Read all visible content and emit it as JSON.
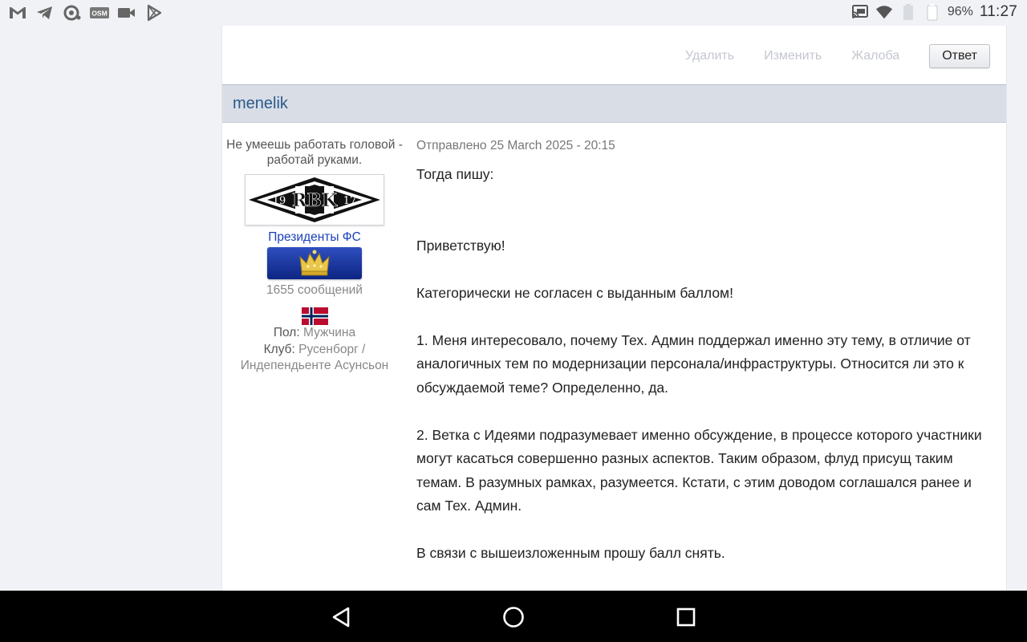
{
  "status": {
    "time": "11:27",
    "battery": "96%",
    "left_icons": [
      "gmail-icon",
      "telegram-icon",
      "music-sync-icon",
      "osm-icon",
      "video-camera-icon",
      "play-store-icon"
    ],
    "osm_label": "OSM"
  },
  "actions": {
    "delete": "Удалить",
    "edit": "Изменить",
    "report": "Жалоба",
    "reply": "Ответ"
  },
  "author": {
    "name": "menelik",
    "tagline": "Не умеешь работать головой - работай руками.",
    "avatar_text": "RBK",
    "avatar_year_left": "19",
    "avatar_year_right": "17",
    "group": "Президенты ФС",
    "post_count": "1655 сообщений",
    "gender_label": "Пол:",
    "gender_value": "Мужчина",
    "club_label": "Клуб:",
    "club_value": "Русенборг / Индепендьенте Асунсьон"
  },
  "post": {
    "date": "Отправлено 25 March 2025 - 20:15",
    "paragraphs": [
      "Тогда пишу:",
      "Приветствую!",
      "Категорически не согласен с выданным баллом!",
      "1. Меня интересовало, почему Тех. Админ поддержал именно эту тему, в отличие от аналогичных тем по модернизации персонала/инфраструктуры. Относится ли это к обсуждаемой теме? Определенно, да.",
      "2. Ветка с Идеями подразумевает именно обсуждение, в процессе которого участники могут касаться совершенно разных аспектов. Таким образом, флуд присущ таким темам. В разумных рамках, разумеется. Кстати, с этим доводом соглашался ранее и сам Тех. Админ.",
      "В связи с вышеизложенным прошу балл снять."
    ]
  },
  "colors": {
    "author_bar": "#d9dde6",
    "author_name": "#2b5a8c",
    "group_name": "#1a3fb8"
  }
}
